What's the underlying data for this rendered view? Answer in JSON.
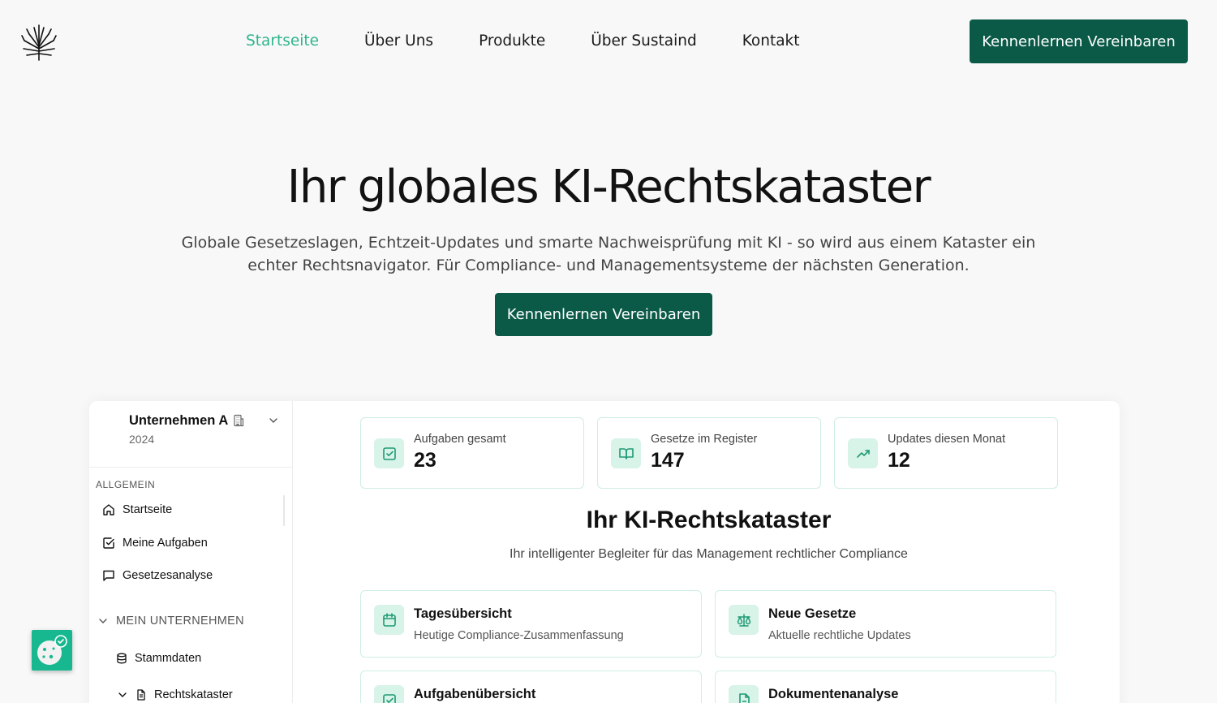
{
  "nav": {
    "logo": "tree-logo",
    "links": [
      "Startseite",
      "Über Uns",
      "Produkte",
      "Über Sustaind",
      "Kontakt"
    ],
    "active_index": 0,
    "cta": "Kennenlernen Vereinbaren"
  },
  "hero": {
    "title": "Ihr globales KI-Rechtskataster",
    "subtitle": "Globale Gesetzeslagen, Echtzeit-Updates und smarte Nachweisprüfung mit KI - so wird aus einem Kataster ein echter Rechtsnavigator. Für Compliance- und Managementsysteme der nächsten Generation.",
    "cta": "Kennenlernen Vereinbaren"
  },
  "app": {
    "company": {
      "name": "Unternehmen A",
      "year": "2024"
    },
    "sidebar": {
      "section_general": "ALLGEMEIN",
      "items": [
        "Startseite",
        "Meine Aufgaben",
        "Gesetzesanalyse"
      ],
      "group_label": "MEIN UNTERNEHMEN",
      "group_items": [
        "Stammdaten",
        "Rechtskataster"
      ]
    },
    "stats": [
      {
        "label": "Aufgaben gesamt",
        "value": "23",
        "icon": "check-square-icon"
      },
      {
        "label": "Gesetze im Register",
        "value": "147",
        "icon": "book-open-icon"
      },
      {
        "label": "Updates diesen Monat",
        "value": "12",
        "icon": "trending-up-icon"
      }
    ],
    "title": "Ihr KI-Rechtskataster",
    "subtitle": "Ihr intelligenter Begleiter für das Management rechtlicher Compliance",
    "cards": [
      {
        "title": "Tagesübersicht",
        "desc": "Heutige Compliance-Zusammenfassung",
        "icon": "calendar-icon"
      },
      {
        "title": "Neue Gesetze",
        "desc": "Aktuelle rechtliche Updates",
        "icon": "scale-icon"
      },
      {
        "title": "Aufgabenübersicht",
        "desc": "",
        "icon": "check-square-icon"
      },
      {
        "title": "Dokumentenanalyse",
        "desc": "",
        "icon": "file-text-icon"
      }
    ]
  },
  "colors": {
    "brand": "#0b5a48",
    "accent": "#2fb58d",
    "tint": "#d8f3e8"
  }
}
